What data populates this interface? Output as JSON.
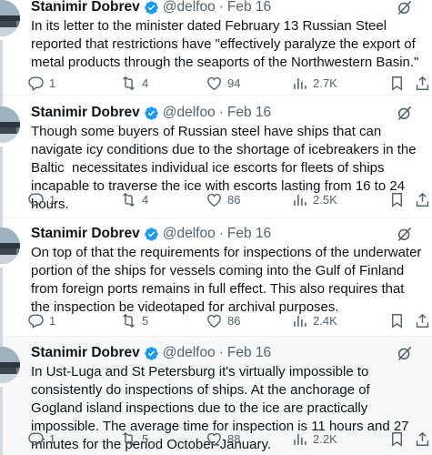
{
  "tweets": [
    {
      "name": "Stanimir Dobrev",
      "handle": "@delfoo",
      "separator": "·",
      "date": "Feb 16",
      "text": "In its letter to the minister dated February 13 Russian Steel reported that restrictions have \"effectively paralyze the export of metal products through the seaports of the Northwestern Basin.\"",
      "replies": "1",
      "reposts": "4",
      "likes": "94",
      "views": "2.7K"
    },
    {
      "name": "Stanimir Dobrev",
      "handle": "@delfoo",
      "separator": "·",
      "date": "Feb 16",
      "text": "Though some buyers of Russian steel have ships that can navigate icy conditions due to the shortage of icebreakers in the Baltic  necessitates individual ice escorts for fleets of ships incapable to traverse the ice with escorts lasting from 16 to 24 hours.",
      "replies": "1",
      "reposts": "4",
      "likes": "86",
      "views": "2.5K"
    },
    {
      "name": "Stanimir Dobrev",
      "handle": "@delfoo",
      "separator": "·",
      "date": "Feb 16",
      "text": "On top of that the requirements for inspections of the underwater portion of the ships for vessels coming into the Gulf of Finland from foreign ports remains in full effect. This also requires that the inspection be videotaped for archival purposes.",
      "replies": "1",
      "reposts": "5",
      "likes": "86",
      "views": "2.4K"
    },
    {
      "name": "Stanimir Dobrev",
      "handle": "@delfoo",
      "separator": "·",
      "date": "Feb 16",
      "text": "In Ust-Luga and St Petersburg it's virtually impossible to consistently do inspections of ships. At the anchorage of Gogland island inspections due to the ice are practically impossible. The average time for inspection is 11 hours and 27 minutes for the period October-January.",
      "replies": "1",
      "reposts": "5",
      "likes": "88",
      "views": "2.2K"
    }
  ],
  "icons": {
    "verified": "verified-badge-icon",
    "grok": "grok-icon",
    "reply": "reply-icon",
    "repost": "repost-icon",
    "like": "like-icon",
    "views": "views-icon",
    "bookmark": "bookmark-icon",
    "share": "share-icon"
  },
  "colors": {
    "verified": "#1d9bf0",
    "secondary_text": "#536471",
    "primary_text": "#0f1419",
    "thread_line": "#cfd9de",
    "highlight_bg": "#f7f9f9"
  }
}
